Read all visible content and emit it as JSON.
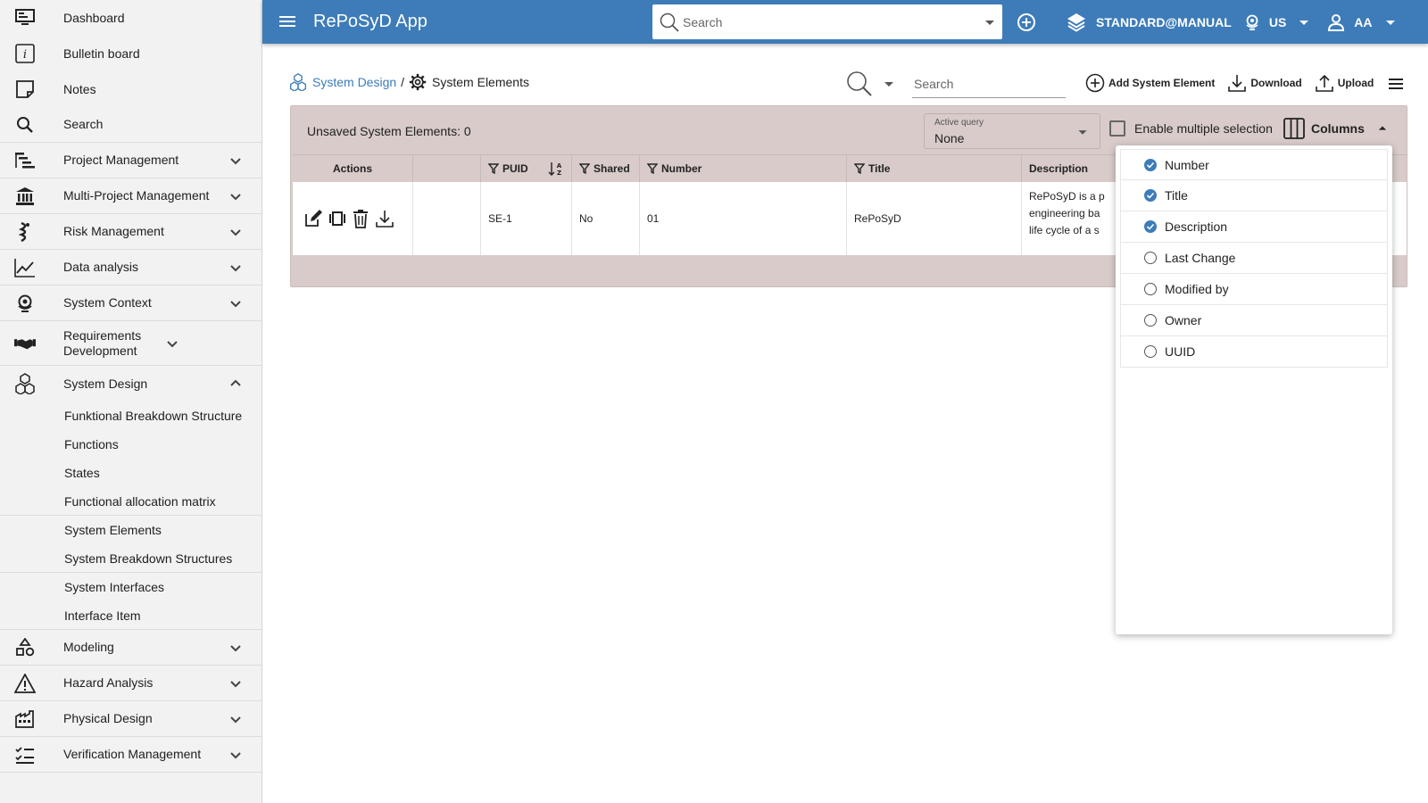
{
  "app": {
    "title": "RePoSyD App"
  },
  "topbar": {
    "search_placeholder": "Search",
    "project": "STANDARD@MANUAL",
    "locale": "US",
    "user": "AA"
  },
  "sidebar": {
    "items": [
      {
        "label": "Dashboard",
        "icon": "monitor-icon"
      },
      {
        "label": "Bulletin board",
        "icon": "info-icon"
      },
      {
        "label": "Notes",
        "icon": "note-icon"
      },
      {
        "label": "Search",
        "icon": "search-icon"
      },
      {
        "label": "Project Management",
        "icon": "tree-icon"
      },
      {
        "label": "Multi-Project Management",
        "icon": "bank-icon"
      },
      {
        "label": "Risk Management",
        "icon": "risk-icon"
      },
      {
        "label": "Data analysis",
        "icon": "chart-line-icon"
      },
      {
        "label": "System Context",
        "icon": "globe-icon"
      },
      {
        "label": "Requirements Development",
        "icon": "handshake-icon"
      },
      {
        "label": "System Design",
        "icon": "cubes-icon"
      }
    ],
    "system_design_sub": [
      "Funktional Breakdown Structure",
      "Functions",
      "States",
      "Functional allocation matrix",
      "System Elements",
      "System Breakdown Structures",
      "System Interfaces",
      "Interface Item"
    ],
    "lower_items": [
      {
        "label": "Modeling",
        "icon": "shapes-icon"
      },
      {
        "label": "Hazard Analysis",
        "icon": "warning-icon"
      },
      {
        "label": "Physical Design",
        "icon": "factory-icon"
      },
      {
        "label": "Verification Management",
        "icon": "checklist-icon"
      }
    ]
  },
  "breadcrumb": {
    "parent": "System Design",
    "separator": "/",
    "current": "System Elements"
  },
  "toolbar": {
    "search_placeholder": "Search",
    "add_label": "Add System Element",
    "download_label": "Download",
    "upload_label": "Upload"
  },
  "panel": {
    "unsaved": "Unsaved System Elements: 0",
    "active_query_label": "Active query",
    "active_query_value": "None",
    "multi_select_label": "Enable multiple selection",
    "columns_label": "Columns"
  },
  "table": {
    "headers": {
      "actions": "Actions",
      "puid": "PUID",
      "shared": "Shared",
      "number": "Number",
      "title": "Title",
      "description": "Description"
    },
    "rows": [
      {
        "puid": "SE-1",
        "shared": "No",
        "number": "01",
        "title": "RePoSyD",
        "desc1": "RePoSyD is a p",
        "desc2": "engineering ba",
        "desc3": "life cycle of a s"
      }
    ]
  },
  "columns_menu": [
    {
      "label": "Number",
      "checked": true
    },
    {
      "label": "Title",
      "checked": true
    },
    {
      "label": "Description",
      "checked": true
    },
    {
      "label": "Last Change",
      "checked": false
    },
    {
      "label": "Modified by",
      "checked": false
    },
    {
      "label": "Owner",
      "checked": false
    },
    {
      "label": "UUID",
      "checked": false
    }
  ],
  "colors": {
    "primary": "#3d7cb8",
    "panel": "#d8cbc9",
    "sidebar": "#f2f2f2"
  }
}
